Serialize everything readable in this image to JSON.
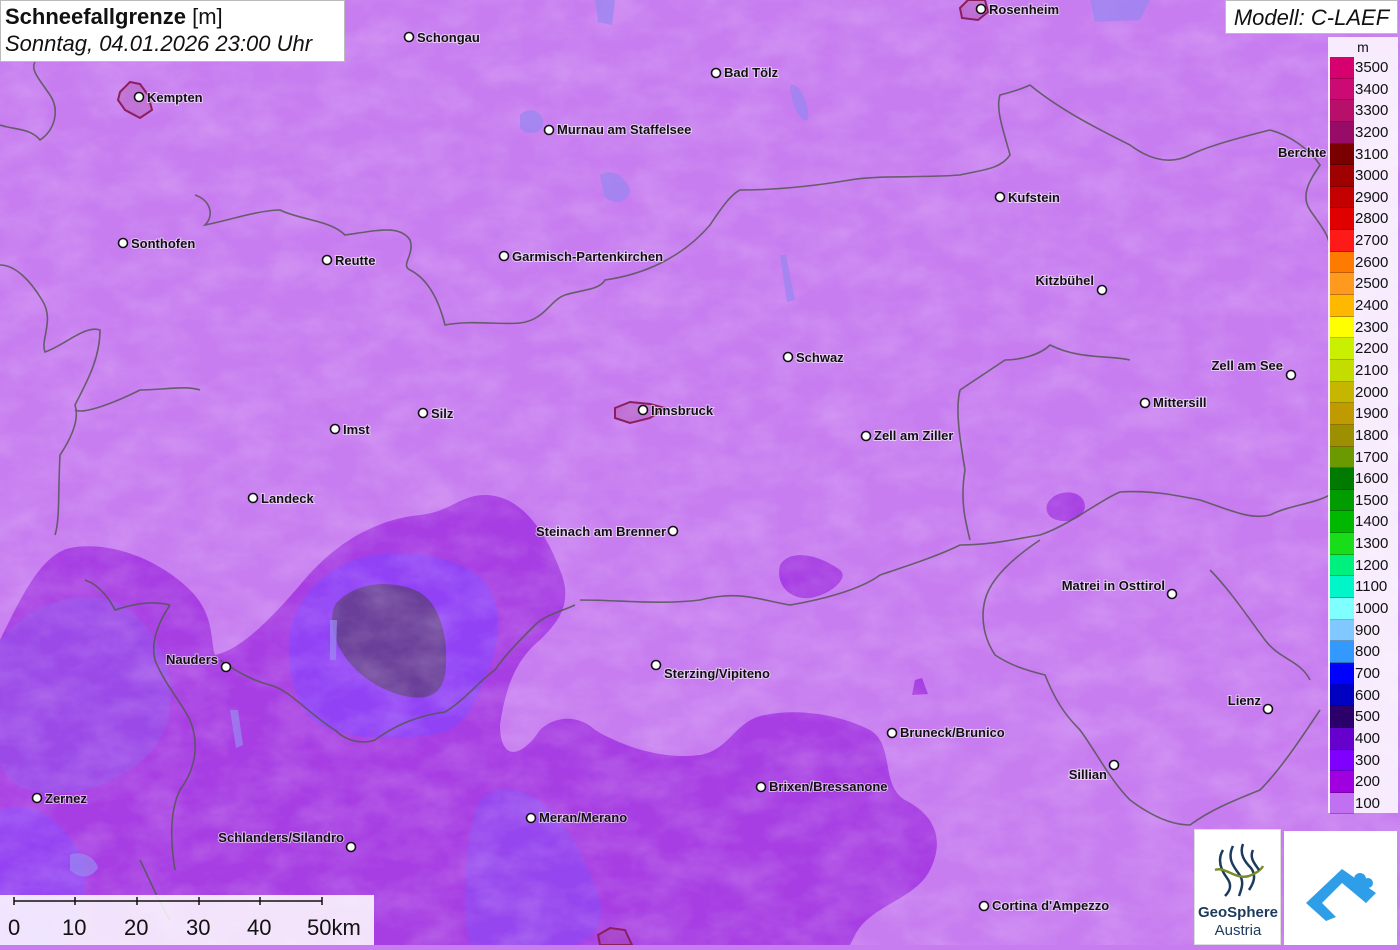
{
  "header": {
    "title": "Schneefallgrenze",
    "unit": "[m]",
    "datetime": "Sonntag, 04.01.2026 23:00 Uhr"
  },
  "model": "Modell: C-LAEF",
  "colors": {
    "base": "#c77cf0",
    "band_200": "#a73ee3",
    "band_300": "#9142f5",
    "band_500": "#5b3a8a",
    "border": "#555555"
  },
  "legend": {
    "unit": "m",
    "items": [
      {
        "value": "3500",
        "color": "#d6006f"
      },
      {
        "value": "3400",
        "color": "#cc0a74"
      },
      {
        "value": "3300",
        "color": "#b80f6b"
      },
      {
        "value": "3200",
        "color": "#980c68"
      },
      {
        "value": "3100",
        "color": "#7a0000"
      },
      {
        "value": "3000",
        "color": "#a10000"
      },
      {
        "value": "2900",
        "color": "#c40000"
      },
      {
        "value": "2800",
        "color": "#e00000"
      },
      {
        "value": "2700",
        "color": "#ff1a1a"
      },
      {
        "value": "2600",
        "color": "#ff7a00"
      },
      {
        "value": "2500",
        "color": "#ff9a1f"
      },
      {
        "value": "2400",
        "color": "#ffb800"
      },
      {
        "value": "2300",
        "color": "#ffff00"
      },
      {
        "value": "2200",
        "color": "#c8f000"
      },
      {
        "value": "2100",
        "color": "#c3dd00"
      },
      {
        "value": "2000",
        "color": "#c7b600"
      },
      {
        "value": "1900",
        "color": "#bf9a00"
      },
      {
        "value": "1800",
        "color": "#9c8f00"
      },
      {
        "value": "1700",
        "color": "#6a9a00"
      },
      {
        "value": "1600",
        "color": "#007a00"
      },
      {
        "value": "1500",
        "color": "#009c00"
      },
      {
        "value": "1400",
        "color": "#00b800"
      },
      {
        "value": "1300",
        "color": "#19dd19"
      },
      {
        "value": "1200",
        "color": "#00f080"
      },
      {
        "value": "1100",
        "color": "#00f5c8"
      },
      {
        "value": "1000",
        "color": "#80ffff"
      },
      {
        "value": "900",
        "color": "#80c8ff"
      },
      {
        "value": "800",
        "color": "#3399ff"
      },
      {
        "value": "700",
        "color": "#0000ff"
      },
      {
        "value": "600",
        "color": "#0000c0"
      },
      {
        "value": "500",
        "color": "#2b006b"
      },
      {
        "value": "400",
        "color": "#6600cc"
      },
      {
        "value": "300",
        "color": "#8000ff"
      },
      {
        "value": "200",
        "color": "#a000e0"
      },
      {
        "value": "100",
        "color": "#c070f0"
      }
    ]
  },
  "cities": {
    "rosenheim": "Rosenheim",
    "schongau": "Schongau",
    "kempten": "Kempten",
    "bad_toelz": "Bad Tölz",
    "murnau": "Murnau am Staffelsee",
    "berchtesgaden": "Berchte",
    "kufstein": "Kufstein",
    "sonthofen": "Sonthofen",
    "reutte": "Reutte",
    "garmisch": "Garmisch-Partenkirchen",
    "kitzbuehel": "Kitzbühel",
    "schwaz": "Schwaz",
    "zell_am_see": "Zell am See",
    "mittersill": "Mittersill",
    "silz": "Silz",
    "innsbruck": "Innsbruck",
    "imst": "Imst",
    "zell_am_ziller": "Zell am Ziller",
    "landeck": "Landeck",
    "steinach": "Steinach am Brenner",
    "matrei": "Matrei in Osttirol",
    "nauders": "Nauders",
    "sterzing": "Sterzing/Vipiteno",
    "lienz": "Lienz",
    "bruneck": "Bruneck/Brunico",
    "sillian": "Sillian",
    "brixen": "Brixen/Bressanone",
    "zernez": "Zernez",
    "meran": "Meran/Merano",
    "schlanders": "Schlanders/Silandro",
    "cortina": "Cortina d'Ampezzo"
  },
  "scalebar": {
    "labels": [
      "0",
      "10",
      "20",
      "30",
      "40",
      "50km"
    ]
  },
  "logos": {
    "geosphere_name": "GeoSphere",
    "geosphere_sub": "Austria"
  }
}
